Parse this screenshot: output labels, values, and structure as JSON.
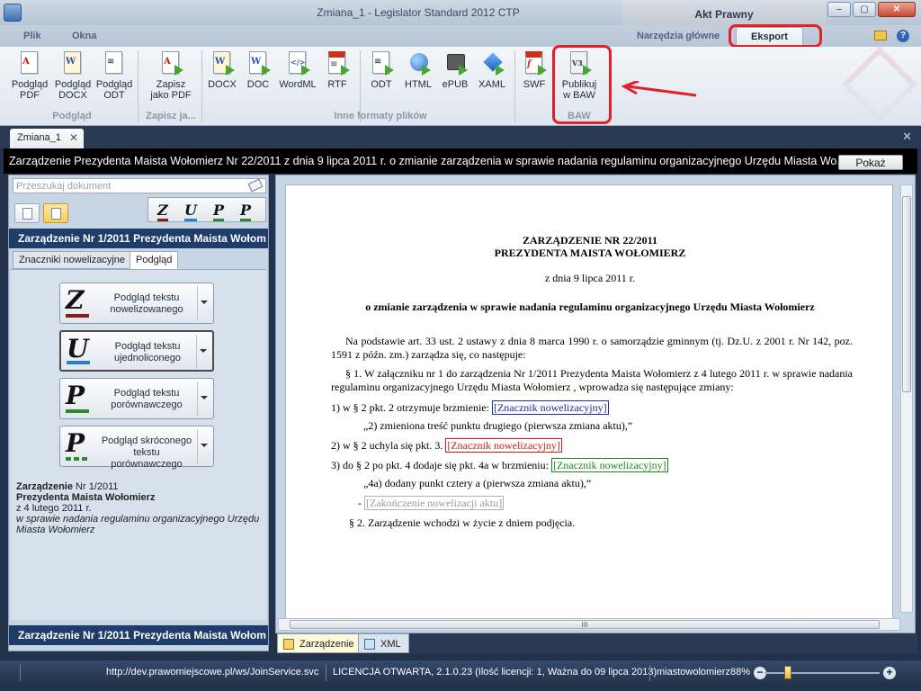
{
  "window": {
    "title": "Zmiana_1 - Legislator Standard 2012 CTP",
    "context_group": "Akt Prawny",
    "minimize": "‒",
    "maximize": "▢",
    "close": "✕"
  },
  "menu_tabs": {
    "plik": "Plik",
    "okna": "Okna",
    "narzedzia": "Narzędzia główne",
    "eksport": "Eksport"
  },
  "ribbon": {
    "buttons": [
      {
        "label1": "Podgląd",
        "label2": "PDF",
        "icon": "pdf-icon"
      },
      {
        "label1": "Podgląd",
        "label2": "DOCX",
        "icon": "docx-icon"
      },
      {
        "label1": "Podgląd",
        "label2": "ODT",
        "icon": "odt-icon"
      },
      {
        "label1": "Zapisz",
        "label2": "jako PDF",
        "icon": "save-pdf-icon"
      },
      {
        "label1": "DOCX",
        "label2": "",
        "icon": "docx-export-icon"
      },
      {
        "label1": "DOC",
        "label2": "",
        "icon": "doc-export-icon"
      },
      {
        "label1": "WordML",
        "label2": "",
        "icon": "wordml-export-icon"
      },
      {
        "label1": "RTF",
        "label2": "",
        "icon": "rtf-export-icon"
      },
      {
        "label1": "ODT",
        "label2": "",
        "icon": "odt-export-icon"
      },
      {
        "label1": "HTML",
        "label2": "",
        "icon": "html-export-icon"
      },
      {
        "label1": "ePUB",
        "label2": "",
        "icon": "epub-export-icon"
      },
      {
        "label1": "XAML",
        "label2": "",
        "icon": "xaml-export-icon"
      },
      {
        "label1": "SWF",
        "label2": "",
        "icon": "swf-export-icon"
      },
      {
        "label1": "Publikuj",
        "label2": "w BAW",
        "icon": "publish-baw-icon"
      }
    ],
    "groups": {
      "podglad": "Podgląd",
      "zapisz": "Zapisz ja...",
      "inne": "Inne formaty plików",
      "baw": "BAW"
    }
  },
  "document_tab": {
    "label": "Zmiana_1",
    "close": "✕"
  },
  "document_header": {
    "title": "Zarządzenie Prezydenta Maista Wołomierz Nr 22/2011 z dnia 9 lipca 2011 r. o zmianie zarządzenia w sprawie nadania regulaminu organizacyjnego Urzędu Miasta Wo...",
    "show_button": "Pokaż"
  },
  "left_pane": {
    "search_placeholder": "Przeszukaj dokument",
    "letters": [
      "Z",
      "U",
      "P",
      "P"
    ],
    "title": "Zarządzenie Nr 1/2011 Prezydenta Maista Wołom",
    "subtabs": {
      "markers": "Znaczniki nowelizacyjne",
      "preview": "Podgląd"
    },
    "preview_buttons": [
      {
        "glyph": "Z",
        "text": "Podgląd tekstu nowelizowanego",
        "color": "#8b1a1a"
      },
      {
        "glyph": "U",
        "text": "Podgląd tekstu ujednoliconego",
        "color": "#2a7fd0"
      },
      {
        "glyph": "P",
        "text": "Podgląd tekstu porównawczego",
        "color": "#2a8a2a"
      },
      {
        "glyph": "P",
        "text": "Podgląd skróconego tekstu porównawczego",
        "color": "#2a8a2a"
      }
    ],
    "info": {
      "line1_bold": "Zarządzenie",
      "line1_rest": " Nr 1/2011",
      "line2": "Prezydenta Maista Wołomierz",
      "line3": "z 4 lutego 2011 r.",
      "line4": "w sprawie nadania regulaminu organizacyjnego Urzędu Miasta Wołomierz"
    },
    "footer_title": "Zarządzenie Nr 1/2011 Prezydenta Maista Wołom"
  },
  "page": {
    "heading1": "ZARZĄDZENIE NR 22/2011",
    "heading2": "PREZYDENTA MAISTA WOŁOMIERZ",
    "date": "z dnia 9 lipca 2011 r.",
    "subject": "o zmianie zarządzenia w sprawie nadania regulaminu organizacyjnego Urzędu Miasta Wołomierz",
    "basis": "Na podstawie art. 33 ust. 2 ustawy z dnia 8 marca 1990 r. o samorządzie gminnym (tj. Dz.U. z 2001 r. Nr 142, poz. 1591 z późn. zm.) zarządza się, co następuje:",
    "par1": "§ 1. W załączniku nr 1 do zarządzenia Nr 1/2011 Prezydenta Maista Wołomierz z 4 lutego 2011 r. w sprawie nadania regulaminu organizacyjnego Urzędu Miasta Wołomierz , wprowadza się następujące zmiany:",
    "item1": "1) w § 2 pkt. 2 otrzymuje brzmienie:",
    "item1_link": "[Znacznik nowelizacyjny]",
    "item1_quote": "„2) zmieniona treść punktu drugiego (pierwsza zmiana aktu),”",
    "item2": "2) w § 2 uchyla się pkt. 3.",
    "item2_link": "[Znacznik nowelizacyjny]",
    "item3": "3) do § 2 po pkt. 4 dodaje się pkt. 4a w brzmieniu:",
    "item3_link": "[Znacznik nowelizacyjny]",
    "item3_quote": "„4a) dodany punkt cztery a (pierwsza zmiana aktu),”",
    "end_prefix": "-",
    "end_link": "[Zakończenie nowelizacji aktu]",
    "par2": "§ 2. Zarządzenie wchodzi w życie z dniem podjęcia."
  },
  "view_tabs": {
    "zarzadzenie": "Zarządzenie",
    "xml": "XML"
  },
  "status": {
    "url": "http://dev.prawomiejscowe.pl/ws/JoinService.svc",
    "license": "LICENCJA OTWARTA, 2.1.0.23 (Ilość licencji: 1, Ważna do 09 lipca 2013)",
    "user": "miastowolomierz",
    "zoom": "88%",
    "zoom_value": 88,
    "zoom_minus": "−",
    "zoom_plus": "+"
  },
  "scroll": {
    "grip": "III"
  }
}
